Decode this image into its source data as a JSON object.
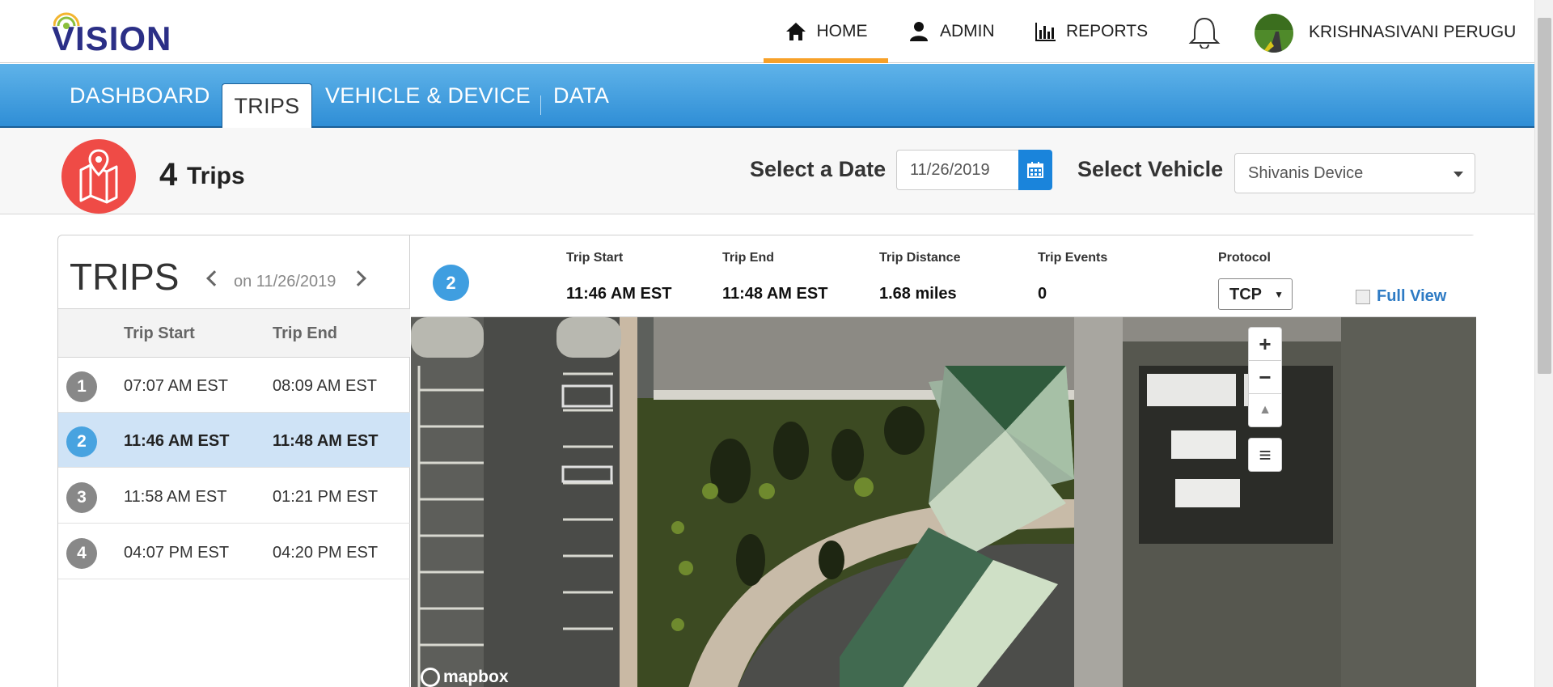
{
  "header": {
    "logo_text": "VISION",
    "nav": [
      {
        "label": "HOME",
        "icon": "home-icon",
        "active": true
      },
      {
        "label": "ADMIN",
        "icon": "user-icon",
        "active": false
      },
      {
        "label": "REPORTS",
        "icon": "bar-chart-icon",
        "active": false
      }
    ],
    "notifications_icon": "bell-icon",
    "user_name": "KRISHNASIVANI PERUGU",
    "accent_color": "#f7a129"
  },
  "tabs": {
    "items": [
      {
        "label": "DASHBOARD",
        "active": false
      },
      {
        "label": "TRIPS",
        "active": true
      },
      {
        "label": "VEHICLE & DEVICE",
        "active": false
      },
      {
        "label": "DATA",
        "active": false
      }
    ],
    "bar_color": "#2f8ed6"
  },
  "filter": {
    "trip_count": "4",
    "trip_count_label": "Trips",
    "date_label": "Select a Date",
    "date_value": "11/26/2019",
    "vehicle_label": "Select Vehicle",
    "vehicle_value": "Shivanis Device",
    "badge_color": "#ef4b46",
    "calendar_icon": "calendar-icon"
  },
  "trips_list": {
    "title": "TRIPS",
    "date_caption": "on 11/26/2019",
    "columns": [
      "Trip Start",
      "Trip End"
    ],
    "rows": [
      {
        "num": "1",
        "start": "07:07 AM EST",
        "end": "08:09 AM EST",
        "selected": false
      },
      {
        "num": "2",
        "start": "11:46 AM EST",
        "end": "11:48 AM EST",
        "selected": true
      },
      {
        "num": "3",
        "start": "11:58 AM EST",
        "end": "01:21 PM EST",
        "selected": false
      },
      {
        "num": "4",
        "start": "04:07 PM EST",
        "end": "04:20 PM EST",
        "selected": false
      }
    ]
  },
  "trip_detail": {
    "trip_number": "2",
    "stats": [
      {
        "label": "Trip Start",
        "value": "11:46 AM EST"
      },
      {
        "label": "Trip End",
        "value": "11:48 AM EST"
      },
      {
        "label": "Trip Distance",
        "value": "1.68 miles"
      },
      {
        "label": "Trip Events",
        "value": "0"
      },
      {
        "label": "Protocol",
        "value": "TCP"
      }
    ],
    "full_view_label": "Full View"
  },
  "map": {
    "attribution": "mapbox",
    "controls": [
      {
        "label": "+",
        "name": "zoom-in-button"
      },
      {
        "label": "−",
        "name": "zoom-out-button"
      },
      {
        "label": "▲",
        "name": "compass-button"
      },
      {
        "label": "≡",
        "name": "layers-button"
      }
    ]
  }
}
